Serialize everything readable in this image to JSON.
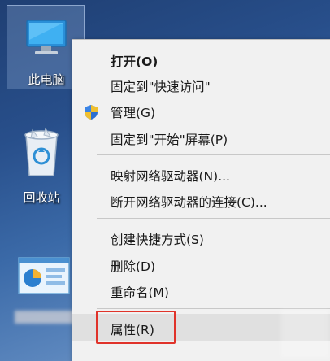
{
  "desktop": {
    "icons": [
      {
        "label": "此电脑",
        "icon": "computer-icon"
      },
      {
        "label": "回收站",
        "icon": "recycle-bin-icon"
      },
      {
        "label": "",
        "icon": "control-panel-icon"
      }
    ]
  },
  "context_menu": {
    "items": [
      {
        "label": "打开(O)",
        "bold": true
      },
      {
        "label": "固定到\"快速访问\""
      },
      {
        "label": "管理(G)",
        "icon": "uac-shield-icon"
      },
      {
        "label": "固定到\"开始\"屏幕(P)"
      },
      {
        "label": "映射网络驱动器(N)..."
      },
      {
        "label": "断开网络驱动器的连接(C)..."
      },
      {
        "label": "创建快捷方式(S)"
      },
      {
        "label": "删除(D)"
      },
      {
        "label": "重命名(M)"
      },
      {
        "label": "属性(R)",
        "highlighted": true
      }
    ]
  },
  "colors": {
    "highlight_box": "#e0332a",
    "menu_background": "#f1f1f1",
    "desktop_background": "#2b5590"
  }
}
